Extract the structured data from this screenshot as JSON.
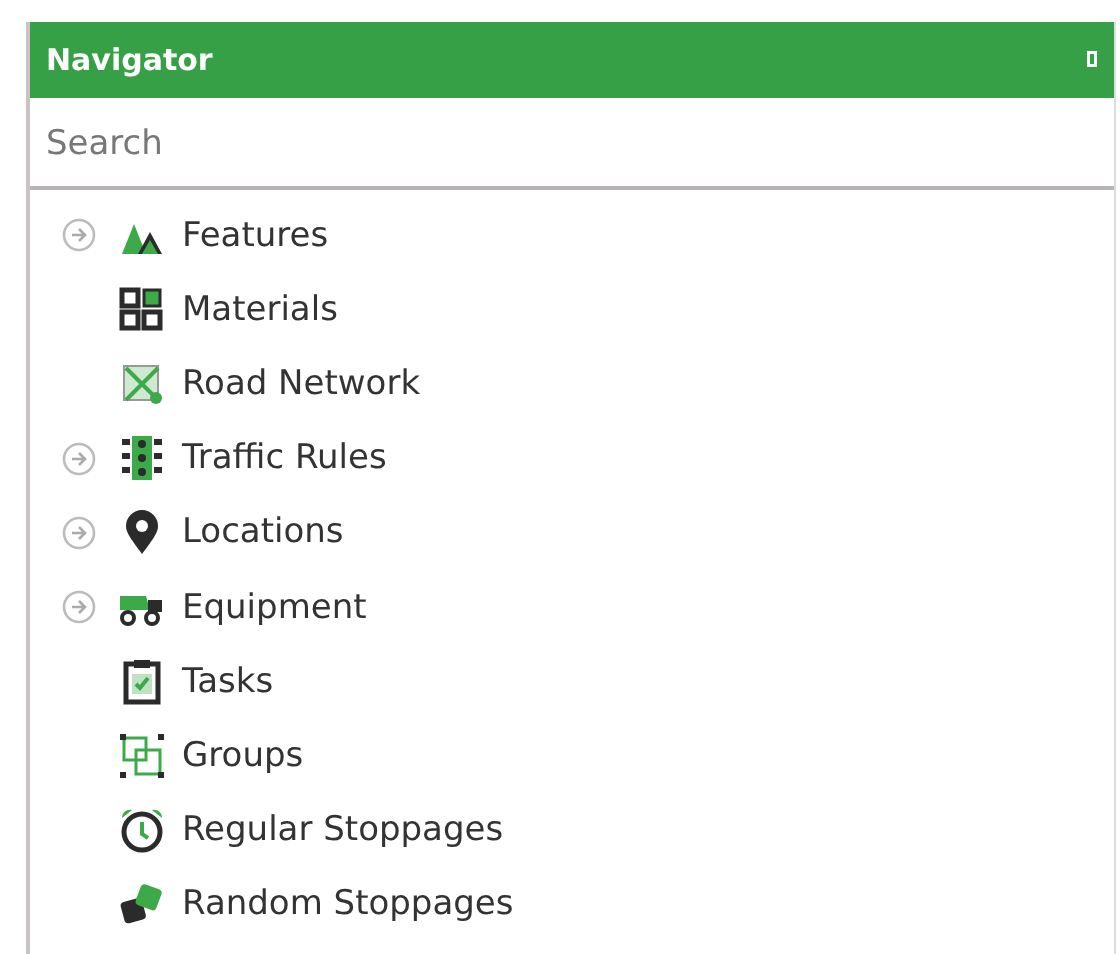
{
  "panel": {
    "title": "Navigator"
  },
  "search": {
    "placeholder": "Search"
  },
  "items": [
    {
      "label": "Features",
      "kind": "group"
    },
    {
      "label": "Materials",
      "kind": "leaf"
    },
    {
      "label": "Road Network",
      "kind": "leaf"
    },
    {
      "label": "Traffic Rules",
      "kind": "group"
    },
    {
      "label": "Locations",
      "kind": "group"
    },
    {
      "label": "Equipment",
      "kind": "group"
    },
    {
      "label": "Tasks",
      "kind": "leaf"
    },
    {
      "label": "Groups",
      "kind": "leaf"
    },
    {
      "label": "Regular Stoppages",
      "kind": "leaf"
    },
    {
      "label": "Random Stoppages",
      "kind": "leaf"
    }
  ]
}
